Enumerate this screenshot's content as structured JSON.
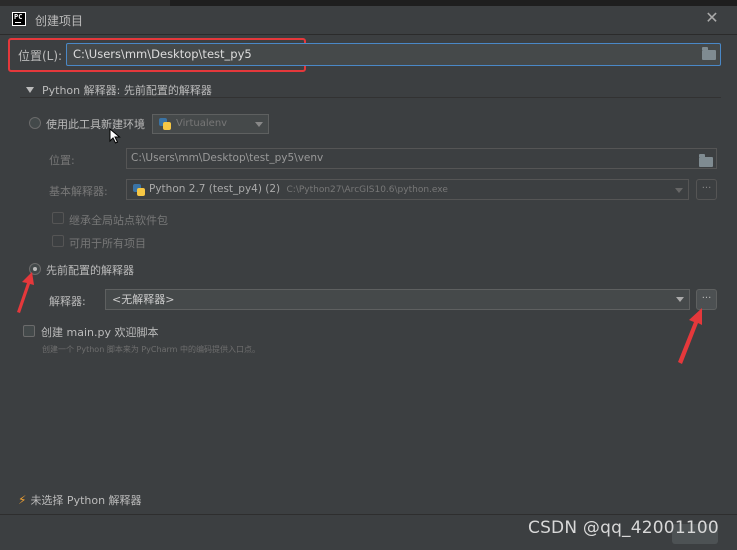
{
  "window": {
    "title": "创建项目",
    "logo_text": "PC",
    "close_label": "✕"
  },
  "location": {
    "label": "位置(L):",
    "value": "C:\\Users\\mm\\Desktop\\test_py5"
  },
  "interpreter_section": {
    "heading": "Python 解释器: 先前配置的解释器"
  },
  "new_env": {
    "radio_label": "使用此工具新建环境",
    "env_type": "Virtualenv",
    "location_label": "位置:",
    "location_value": "C:\\Users\\mm\\Desktop\\test_py5\\venv",
    "base_interp_label": "基本解释器:",
    "base_interp_name": "Python 2.7 (test_py4) (2)",
    "base_interp_path": "C:\\Python27\\ArcGIS10.6\\python.exe",
    "inherit_label": "继承全局站点软件包",
    "all_projects_label": "可用于所有项目",
    "ellipsis": "..."
  },
  "existing": {
    "radio_label": "先前配置的解释器",
    "interp_label": "解释器:",
    "interp_value": "<无解释器>",
    "ellipsis": "..."
  },
  "main_script": {
    "checkbox_label": "创建 main.py 欢迎脚本",
    "hint": "创建一个 Python 脚本来为 PyCharm 中的编码提供入口点。"
  },
  "footer": {
    "warning": "未选择 Python 解释器"
  },
  "watermark": "CSDN @qq_42001100",
  "colors": {
    "background": "#3c3f41",
    "input_focus_border": "#4a88c7",
    "annotation_red": "#e5383b",
    "warning_bolt": "#f0a030"
  }
}
